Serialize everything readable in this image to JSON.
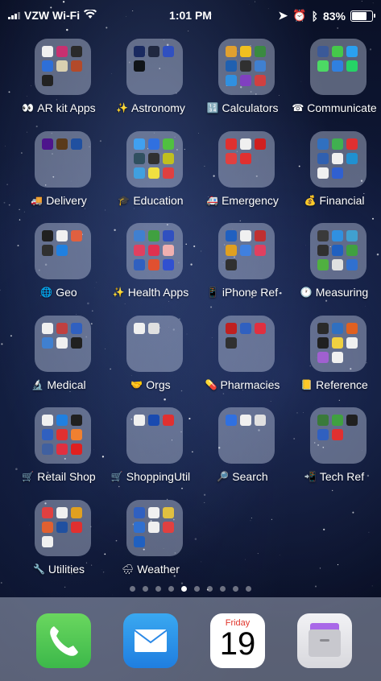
{
  "status": {
    "carrier": "VZW Wi-Fi",
    "time": "1:01 PM",
    "battery": "83%",
    "battery_fraction": 0.83
  },
  "folders": [
    {
      "label": "AR kit Apps",
      "icon": "eyes-icon",
      "emoji": "👀",
      "minis": [
        "#f0f0f0",
        "#c83070",
        "#2a2a2a",
        "#2e6fd8",
        "#d9d0b0",
        "#b34a2a",
        "#222222"
      ]
    },
    {
      "label": "Astronomy",
      "icon": "sparkles-icon",
      "emoji": "✨",
      "minis": [
        "#1a2a60",
        "#202840",
        "#3050c0",
        "#101418"
      ]
    },
    {
      "label": "Calculators",
      "icon": "calculator-icon",
      "emoji": "🔢",
      "minis": [
        "#e0a030",
        "#f0c020",
        "#3a8a40",
        "#2060b0",
        "#303030",
        "#4080d0",
        "#3090e0",
        "#8040c0",
        "#d04040"
      ]
    },
    {
      "label": "Communicate",
      "icon": "telephone-icon",
      "emoji": "☎",
      "minis": [
        "#3b5998",
        "#45c84a",
        "#2aa0f0",
        "#4cd964",
        "#3080e0",
        "#25d366"
      ]
    },
    {
      "label": "Delivery",
      "icon": "truck-icon",
      "emoji": "🚚",
      "minis": [
        "#4d148c",
        "#5a3a1a",
        "#2050a0"
      ]
    },
    {
      "label": "Education",
      "icon": "graduation-icon",
      "emoji": "🎓",
      "minis": [
        "#40a0f0",
        "#3070e0",
        "#50c040",
        "#305060",
        "#303030",
        "#c0c020",
        "#40a0e0",
        "#f0e040",
        "#e04040"
      ]
    },
    {
      "label": "Emergency",
      "icon": "ambulance-icon",
      "emoji": "🚑",
      "minis": [
        "#e03030",
        "#f0f0f0",
        "#d02020",
        "#e04040",
        "#e03030"
      ]
    },
    {
      "label": "Financial",
      "icon": "money-bag-icon",
      "emoji": "💰",
      "minis": [
        "#3070c0",
        "#40b050",
        "#e03030",
        "#3060b0",
        "#f0f0f0",
        "#2090d0",
        "#f0f0f0",
        "#3060d0"
      ]
    },
    {
      "label": "Geo",
      "icon": "globe-icon",
      "emoji": "🌐",
      "minis": [
        "#202020",
        "#f0f0f0",
        "#e06040",
        "#303030",
        "#2080e0"
      ]
    },
    {
      "label": "Health Apps",
      "icon": "sparkle-person-icon",
      "emoji": "✨",
      "minis": [
        "#4080d0",
        "#40a040",
        "#3050c0",
        "#e04060",
        "#e03050",
        "#f0b0b0",
        "#3060c0",
        "#e05030",
        "#3050d0"
      ]
    },
    {
      "label": "iPhone Ref",
      "icon": "phone-icon",
      "emoji": "📱",
      "minis": [
        "#2060c0",
        "#f0f0f0",
        "#c03030",
        "#e0a020",
        "#4080e0",
        "#e04060",
        "#303030"
      ]
    },
    {
      "label": "Measuring",
      "icon": "clock-icon",
      "emoji": "🕐",
      "minis": [
        "#3a3a3a",
        "#3090e0",
        "#40a0d0",
        "#303030",
        "#2060c0",
        "#40a040",
        "#50b040",
        "#e0e0e0",
        "#3070d0"
      ]
    },
    {
      "label": "Medical",
      "icon": "microscope-icon",
      "emoji": "🔬",
      "minis": [
        "#f0f0f0",
        "#c04040",
        "#3060c0",
        "#4080d0",
        "#f0f0f0",
        "#202020"
      ]
    },
    {
      "label": "Orgs",
      "icon": "handshake-icon",
      "emoji": "🤝",
      "minis": [
        "#f0f0f0",
        "#e0e0e0"
      ]
    },
    {
      "label": "Pharmacies",
      "icon": "pill-icon",
      "emoji": "💊",
      "minis": [
        "#c02020",
        "#3060c0",
        "#e03040",
        "#303030"
      ]
    },
    {
      "label": "Reference",
      "icon": "book-icon",
      "emoji": "📒",
      "minis": [
        "#2a2a2a",
        "#3070c0",
        "#e06020",
        "#202020",
        "#f0d040",
        "#f0f0f0",
        "#a060d0",
        "#f0f0f0"
      ]
    },
    {
      "label": "Retail Shop",
      "icon": "cart-icon",
      "emoji": "🛒",
      "minis": [
        "#f0f0f0",
        "#2080e0",
        "#202020",
        "#3060c0",
        "#e03030",
        "#f08030",
        "#4060a0",
        "#e03040",
        "#e02020"
      ]
    },
    {
      "label": "ShoppingUtil",
      "icon": "cart-icon",
      "emoji": "🛒",
      "minis": [
        "#f0f0f0",
        "#1a4ab0",
        "#e03030"
      ]
    },
    {
      "label": "Search",
      "icon": "magnifier-icon",
      "emoji": "🔎",
      "minis": [
        "#3070e0",
        "#f0f0f0",
        "#e0e0e0"
      ]
    },
    {
      "label": "Tech Ref",
      "icon": "mobile-icon",
      "emoji": "📲",
      "minis": [
        "#3a7a3a",
        "#40a040",
        "#202020",
        "#3060c0",
        "#e03030"
      ]
    },
    {
      "label": "Utilities",
      "icon": "wrench-icon",
      "emoji": "🔧",
      "minis": [
        "#e04040",
        "#f0f0f0",
        "#e0a020",
        "#e06030",
        "#2050a0",
        "#e03030",
        "#f0f0f0"
      ]
    },
    {
      "label": "Weather",
      "icon": "rain-cloud-icon",
      "emoji": "🌧",
      "minis": [
        "#3060c0",
        "#f0f0f0",
        "#e0c040",
        "#3070d0",
        "#f0f0f0",
        "#e04040",
        "#2060c0"
      ]
    }
  ],
  "page_dots": {
    "count": 10,
    "active": 5
  },
  "dock": {
    "phone_icon": "phone-icon",
    "mail_icon": "mail-icon",
    "calendar_day": "Friday",
    "calendar_date": "19",
    "files_icon": "files-icon"
  }
}
